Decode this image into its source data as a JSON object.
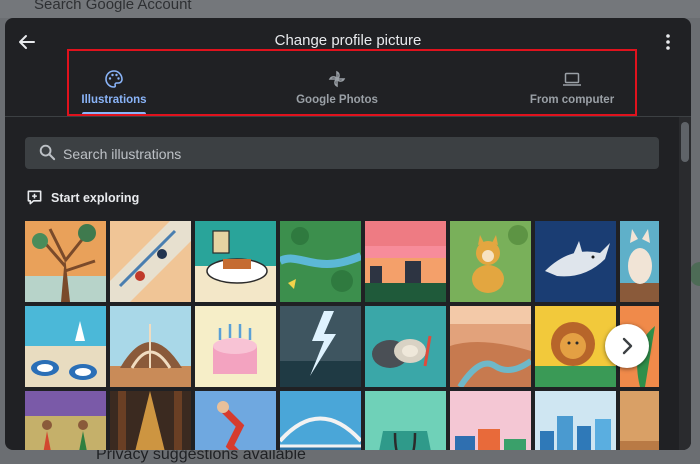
{
  "background": {
    "search_placeholder": "Search Google Account",
    "bottom_text": "Privacy suggestions available"
  },
  "dialog": {
    "title": "Change profile picture",
    "tabs": [
      {
        "label": "Illustrations",
        "icon": "palette-icon",
        "active": true
      },
      {
        "label": "Google Photos",
        "icon": "pinwheel-icon",
        "active": false
      },
      {
        "label": "From computer",
        "icon": "laptop-icon",
        "active": false
      }
    ],
    "search": {
      "placeholder": "Search illustrations",
      "value": ""
    },
    "section": {
      "label": "Start exploring",
      "icon": "explore-icon"
    }
  },
  "colors": {
    "dialog_bg": "#202124",
    "accent": "#8ab4f8",
    "highlight_box": "#e0121d",
    "text": "#e8eaed"
  }
}
